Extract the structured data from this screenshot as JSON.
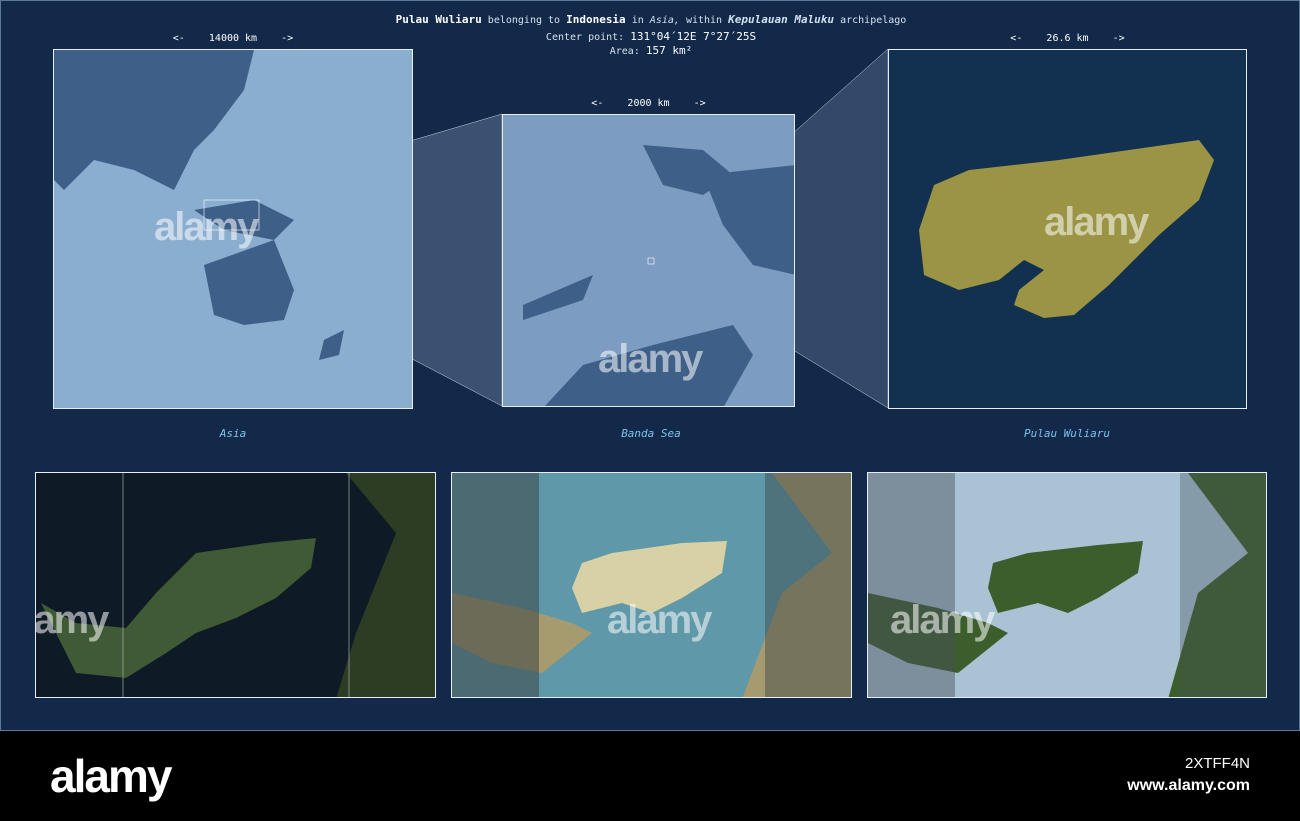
{
  "header": {
    "island": "Pulau Wuliaru",
    "belonging": "belonging to",
    "country": "Indonesia",
    "in": "in",
    "continent": "Asia,",
    "within": "within",
    "archipelago_name": "Kepulauan Maluku",
    "archipelago": "archipelago",
    "center_label": "Center point:",
    "center_value": "131°04´12E  7°27´25S",
    "area_label": "Area:",
    "area_value": "157 km²"
  },
  "maps": [
    {
      "label": "Asia",
      "scale": "<-    14000 km    ->"
    },
    {
      "label": "Banda Sea",
      "scale": "<-    2000 km    ->"
    },
    {
      "label": "Pulau Wuliaru",
      "scale": "<-    26.6 km    ->"
    }
  ],
  "watermark": "alamy",
  "footer": {
    "logo": "alamy",
    "image_id": "2XTFF4N",
    "url": "www.alamy.com"
  },
  "colors": {
    "background": "#13294a",
    "island": "#9a9444",
    "ocean_light": "#8aaed0"
  }
}
